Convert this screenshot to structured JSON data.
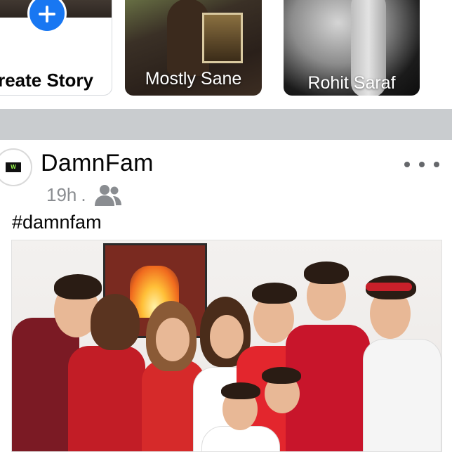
{
  "stories": {
    "create_label": "reate Story",
    "items": [
      {
        "name": "Mostly Sane"
      },
      {
        "name": "Rohit Saraf"
      }
    ]
  },
  "post": {
    "avatar_logo": "W",
    "page_name": "DamnFam",
    "time": "19h",
    "separator": ".",
    "audience_icon": "friends-icon",
    "more_icon": "more-dots-icon",
    "caption": "#damnfam"
  },
  "colors": {
    "accent": "#1877f2",
    "divider": "#c9cccf",
    "secondary_text": "#8a8d91",
    "icon_gray": "#65676b"
  }
}
